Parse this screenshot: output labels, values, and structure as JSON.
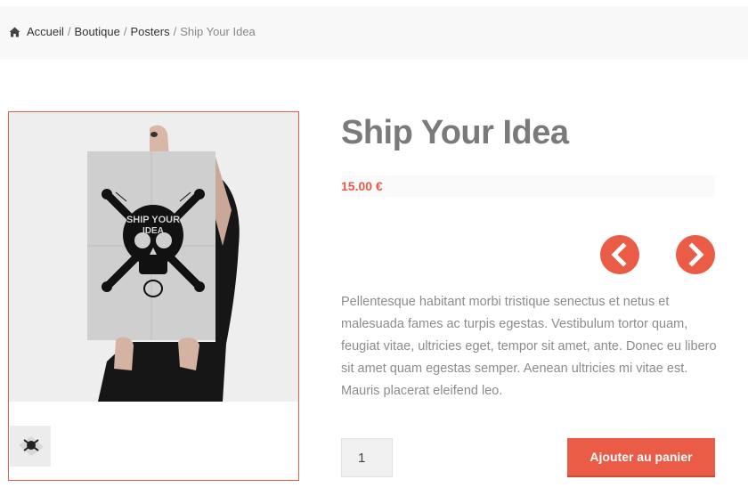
{
  "breadcrumb": {
    "home": "Accueil",
    "shop": "Boutique",
    "category": "Posters",
    "current": "Ship Your Idea",
    "separator": "/"
  },
  "product": {
    "title": "Ship Your Idea",
    "price": "15.00 €",
    "description": "Pellentesque habitant morbi tristique senectus et netus et malesuada fames ac turpis egestas. Vestibulum tortor quam, feugiat vitae, ultricies eget, tempor sit amet, ante. Donec eu libero sit amet quam egestas semper. Aenean ultricies mi vitae est. Mauris placerat eleifend leo.",
    "quantity": "1",
    "add_to_cart_label": "Ajouter au panier"
  },
  "colors": {
    "accent": "#ea5c46",
    "price": "#e25d4a",
    "title": "#7a7a7a"
  },
  "icons": {
    "home": "home-icon",
    "prev": "chevron-left-icon",
    "next": "chevron-right-icon"
  }
}
